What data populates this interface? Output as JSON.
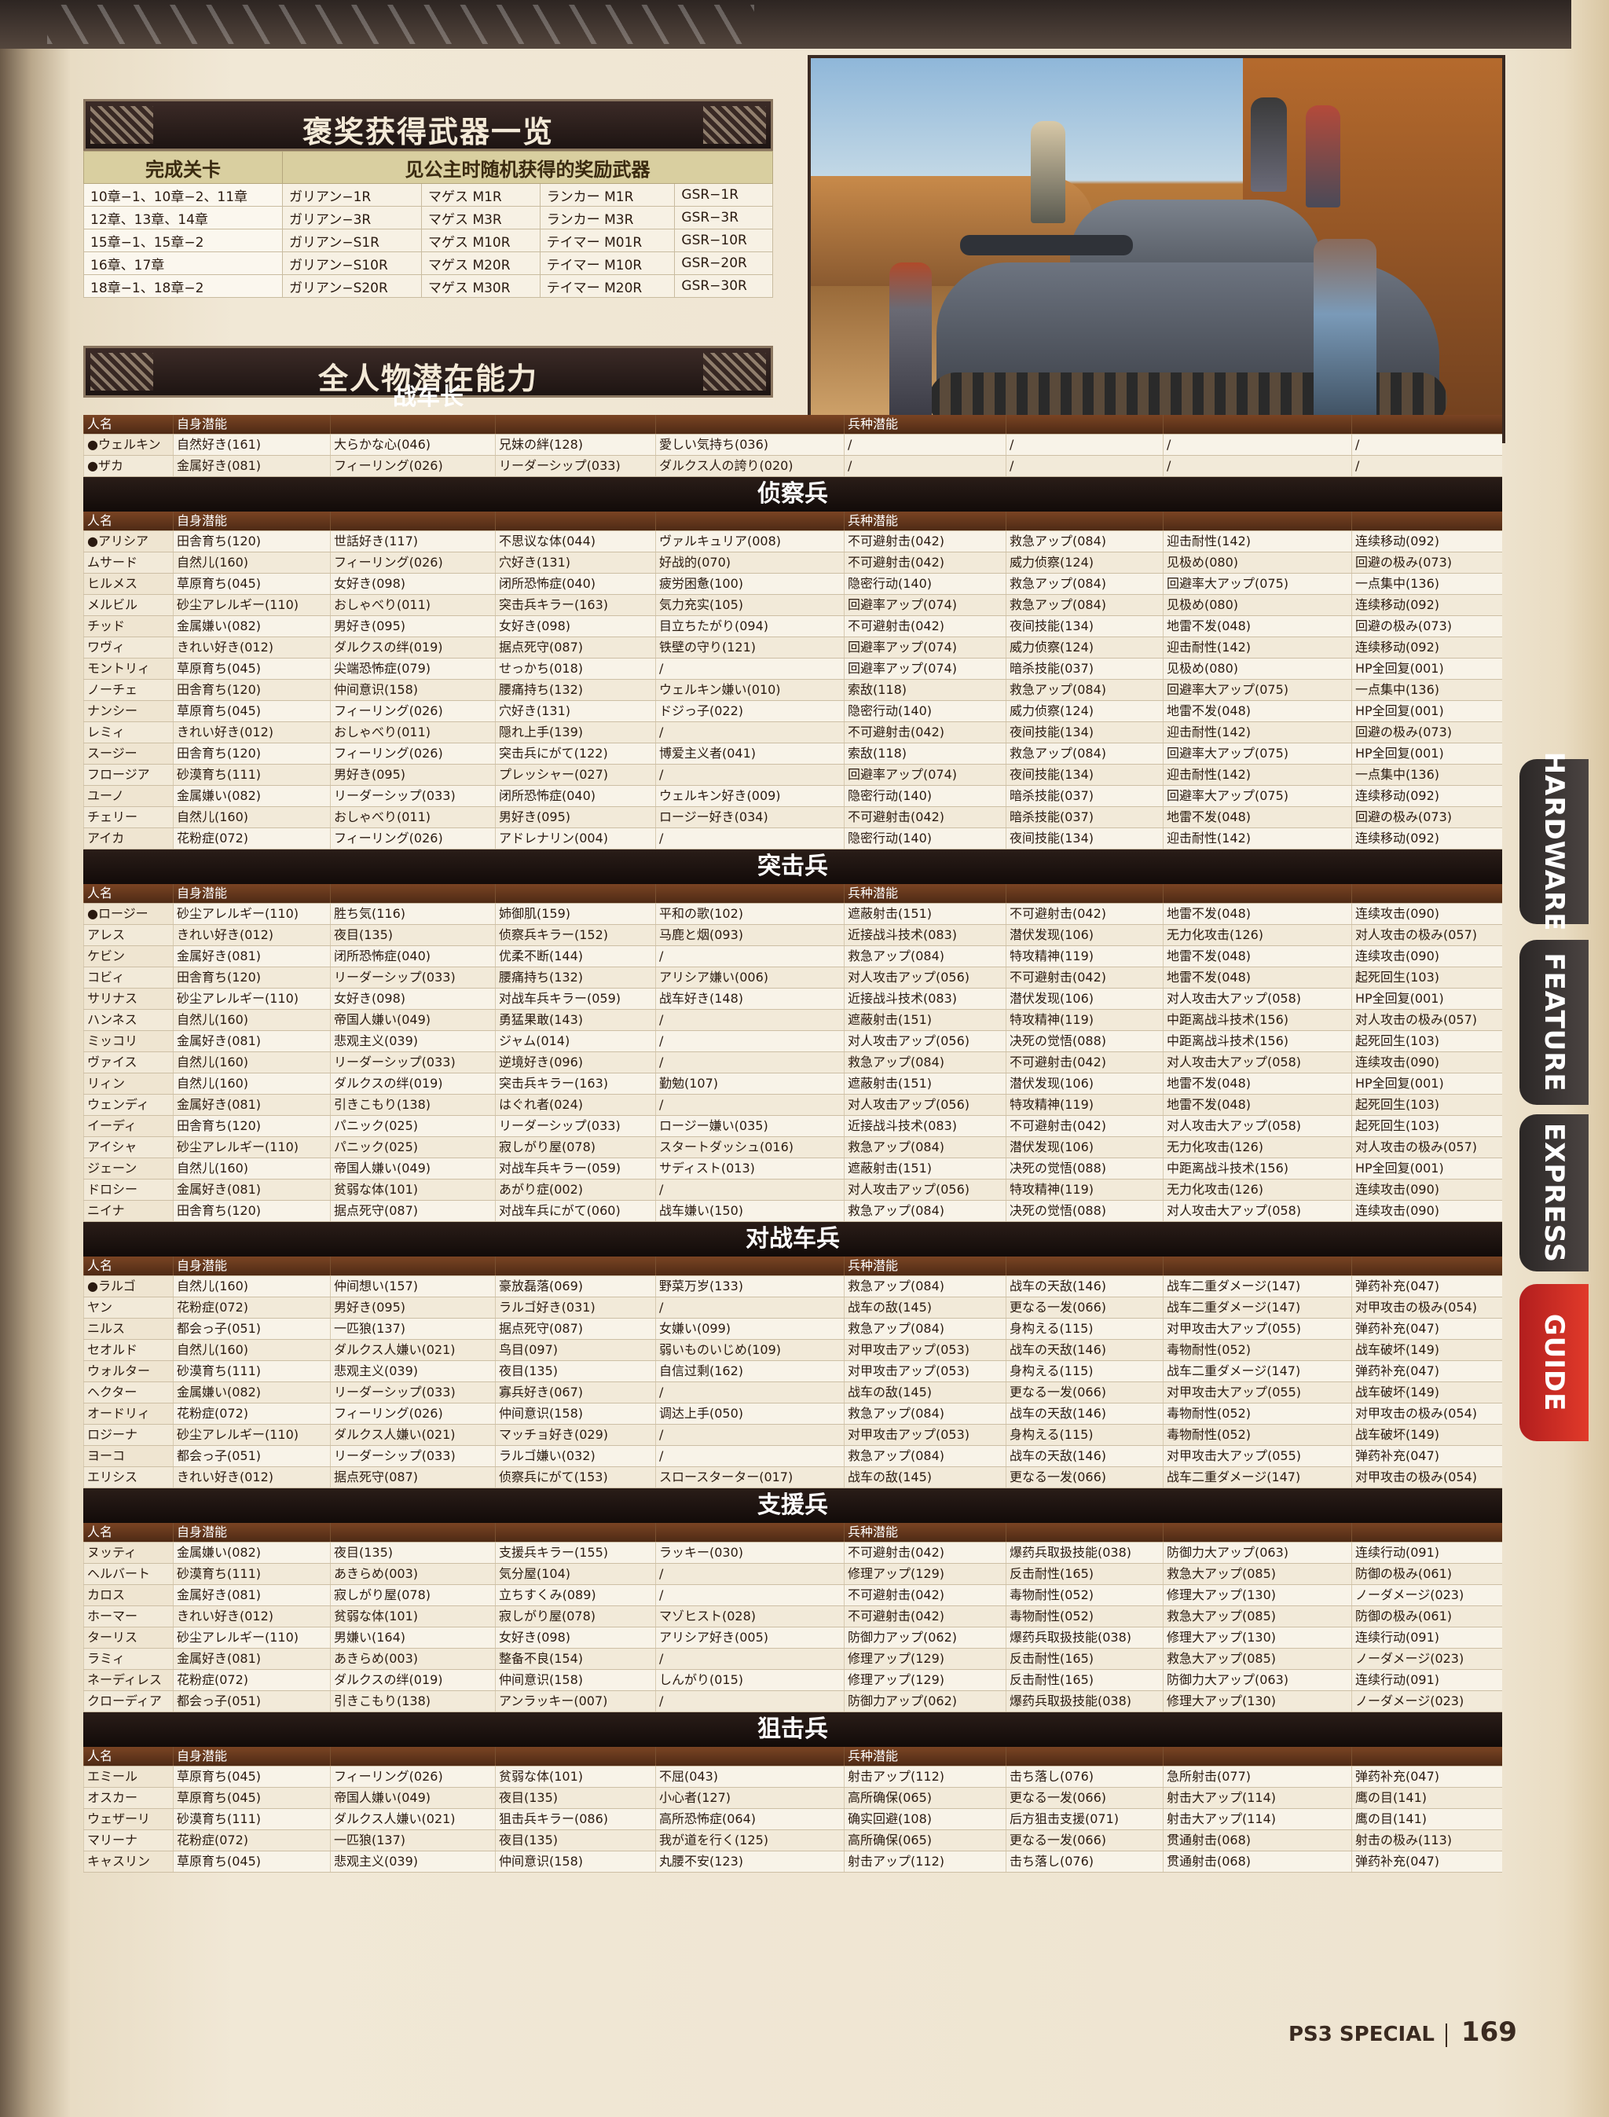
{
  "bonus_weapons": {
    "title": "褒奖获得武器一览",
    "col_stage": "完成关卡",
    "col_weapons": "见公主时随机获得的奖励武器",
    "rows": [
      [
        "10章−1、10章−2、11章",
        "ガリアン−1R",
        "マゲス M1R",
        "ランカー M1R",
        "GSR−1R"
      ],
      [
        "12章、13章、14章",
        "ガリアン−3R",
        "マゲス M3R",
        "ランカー M3R",
        "GSR−3R"
      ],
      [
        "15章−1、15章−2",
        "ガリアン−S1R",
        "マゲス M10R",
        "テイマー M01R",
        "GSR−10R"
      ],
      [
        "16章、17章",
        "ガリアン−S10R",
        "マゲス M20R",
        "テイマー M10R",
        "GSR−20R"
      ],
      [
        "18章−1、18章−2",
        "ガリアン−S20R",
        "マゲス M30R",
        "テイマー M20R",
        "GSR−30R"
      ]
    ]
  },
  "potential": {
    "title": "全人物潜在能力",
    "header": {
      "name": "人名",
      "self": "自身潜能",
      "class": "兵种潜能"
    },
    "classes": [
      {
        "name": "战车长",
        "rows": [
          [
            "●ウェルキン",
            "自然好き(161)",
            "大らかな心(046)",
            "兄妹の絆(128)",
            "愛しい気持ち(036)",
            "/",
            "/",
            "/",
            "/"
          ],
          [
            "●ザカ",
            "金属好き(081)",
            "フィーリング(026)",
            "リーダーシップ(033)",
            "ダルクス人の誇り(020)",
            "/",
            "/",
            "/",
            "/"
          ]
        ]
      },
      {
        "name": "侦察兵",
        "rows": [
          [
            "●アリシア",
            "田舎育ち(120)",
            "世話好き(117)",
            "不思议な体(044)",
            "ヴァルキュリア(008)",
            "不可避射击(042)",
            "救急アップ(084)",
            "迎击耐性(142)",
            "连续移动(092)"
          ],
          [
            "ムサード",
            "自然儿(160)",
            "フィーリング(026)",
            "穴好き(131)",
            "好战的(070)",
            "不可避射击(042)",
            "威力侦察(124)",
            "见极め(080)",
            "回避の极み(073)"
          ],
          [
            "ヒルメス",
            "草原育ち(045)",
            "女好き(098)",
            "闭所恐怖症(040)",
            "疲労困惫(100)",
            "隐密行动(140)",
            "救急アップ(084)",
            "回避率大アップ(075)",
            "一点集中(136)"
          ],
          [
            "メルビル",
            "砂尘アレルギー(110)",
            "おしゃべり(011)",
            "突击兵キラー(163)",
            "気力充实(105)",
            "回避率アップ(074)",
            "救急アップ(084)",
            "见极め(080)",
            "连续移动(092)"
          ],
          [
            "チッド",
            "金属嫌い(082)",
            "男好き(095)",
            "女好き(098)",
            "目立ちたがり(094)",
            "不可避射击(042)",
            "夜间技能(134)",
            "地雷不发(048)",
            "回避の极み(073)"
          ],
          [
            "ワヴィ",
            "きれい好き(012)",
            "ダルクスの绊(019)",
            "据点死守(087)",
            "铁壁の守り(121)",
            "回避率アップ(074)",
            "威力侦察(124)",
            "迎击耐性(142)",
            "连续移动(092)"
          ],
          [
            "モントリィ",
            "草原育ち(045)",
            "尖端恐怖症(079)",
            "せっかち(018)",
            "/",
            "回避率アップ(074)",
            "暗杀技能(037)",
            "见极め(080)",
            "HP全回复(001)"
          ],
          [
            "ノーチェ",
            "田舎育ち(120)",
            "仲间意识(158)",
            "腰痛持ち(132)",
            "ウェルキン嫌い(010)",
            "索敌(118)",
            "救急アップ(084)",
            "回避率大アップ(075)",
            "一点集中(136)"
          ],
          [
            "ナンシー",
            "草原育ち(045)",
            "フィーリング(026)",
            "穴好き(131)",
            "ドジっ子(022)",
            "隐密行动(140)",
            "威力侦察(124)",
            "地雷不发(048)",
            "HP全回复(001)"
          ],
          [
            "レミィ",
            "きれい好き(012)",
            "おしゃべり(011)",
            "隠れ上手(139)",
            "/",
            "不可避射击(042)",
            "夜间技能(134)",
            "迎击耐性(142)",
            "回避の极み(073)"
          ],
          [
            "スージー",
            "田舎育ち(120)",
            "フィーリング(026)",
            "突击兵にがて(122)",
            "博爱主义者(041)",
            "索敌(118)",
            "救急アップ(084)",
            "回避率大アップ(075)",
            "HP全回复(001)"
          ],
          [
            "フロージア",
            "砂漠育ち(111)",
            "男好き(095)",
            "プレッシャー(027)",
            "/",
            "回避率アップ(074)",
            "夜间技能(134)",
            "迎击耐性(142)",
            "一点集中(136)"
          ],
          [
            "ユーノ",
            "金属嫌い(082)",
            "リーダーシップ(033)",
            "闭所恐怖症(040)",
            "ウェルキン好き(009)",
            "隐密行动(140)",
            "暗杀技能(037)",
            "回避率大アップ(075)",
            "连续移动(092)"
          ],
          [
            "チェリー",
            "自然儿(160)",
            "おしゃべり(011)",
            "男好き(095)",
            "ロージー好き(034)",
            "不可避射击(042)",
            "暗杀技能(037)",
            "地雷不发(048)",
            "回避の极み(073)"
          ],
          [
            "アイカ",
            "花粉症(072)",
            "フィーリング(026)",
            "アドレナリン(004)",
            "/",
            "隐密行动(140)",
            "夜间技能(134)",
            "迎击耐性(142)",
            "连续移动(092)"
          ]
        ]
      },
      {
        "name": "突击兵",
        "rows": [
          [
            "●ロージー",
            "砂尘アレルギー(110)",
            "胜ち気(116)",
            "姉御肌(159)",
            "平和の歌(102)",
            "遮蔽射击(151)",
            "不可避射击(042)",
            "地雷不发(048)",
            "连续攻击(090)"
          ],
          [
            "アレス",
            "きれい好き(012)",
            "夜目(135)",
            "侦察兵キラー(152)",
            "马鹿と烟(093)",
            "近接战斗技术(083)",
            "潜伏发现(106)",
            "无力化攻击(126)",
            "对人攻击の极み(057)"
          ],
          [
            "ケビン",
            "金属好き(081)",
            "闭所恐怖症(040)",
            "优柔不断(144)",
            "/",
            "救急アップ(084)",
            "特攻精神(119)",
            "地雷不发(048)",
            "连续攻击(090)"
          ],
          [
            "コビィ",
            "田舎育ち(120)",
            "リーダーシップ(033)",
            "腰痛持ち(132)",
            "アリシア嫌い(006)",
            "对人攻击アップ(056)",
            "不可避射击(042)",
            "地雷不发(048)",
            "起死回生(103)"
          ],
          [
            "サリナス",
            "砂尘アレルギー(110)",
            "女好き(098)",
            "对战车兵キラー(059)",
            "战车好き(148)",
            "近接战斗技术(083)",
            "潜伏发现(106)",
            "对人攻击大アップ(058)",
            "HP全回复(001)"
          ],
          [
            "ハンネス",
            "自然儿(160)",
            "帝国人嫌い(049)",
            "勇猛果敢(143)",
            "/",
            "遮蔽射击(151)",
            "特攻精神(119)",
            "中距离战斗技术(156)",
            "对人攻击の极み(057)"
          ],
          [
            "ミッコリ",
            "金属好き(081)",
            "悲观主义(039)",
            "ジャム(014)",
            "/",
            "对人攻击アップ(056)",
            "决死の觉悟(088)",
            "中距离战斗技术(156)",
            "起死回生(103)"
          ],
          [
            "ヴァイス",
            "自然儿(160)",
            "リーダーシップ(033)",
            "逆境好き(096)",
            "/",
            "救急アップ(084)",
            "不可避射击(042)",
            "对人攻击大アップ(058)",
            "连续攻击(090)"
          ],
          [
            "リィン",
            "自然儿(160)",
            "ダルクスの绊(019)",
            "突击兵キラー(163)",
            "勤勉(107)",
            "遮蔽射击(151)",
            "潜伏发现(106)",
            "地雷不发(048)",
            "HP全回复(001)"
          ],
          [
            "ウェンディ",
            "金属好き(081)",
            "引きこもり(138)",
            "はぐれ者(024)",
            "/",
            "对人攻击アップ(056)",
            "特攻精神(119)",
            "地雷不发(048)",
            "起死回生(103)"
          ],
          [
            "イーディ",
            "田舎育ち(120)",
            "パニック(025)",
            "リーダーシップ(033)",
            "ロージー嫌い(035)",
            "近接战斗技术(083)",
            "不可避射击(042)",
            "对人攻击大アップ(058)",
            "起死回生(103)"
          ],
          [
            "アイシャ",
            "砂尘アレルギー(110)",
            "パニック(025)",
            "寂しがり屋(078)",
            "スタートダッシュ(016)",
            "救急アップ(084)",
            "潜伏发现(106)",
            "无力化攻击(126)",
            "对人攻击の极み(057)"
          ],
          [
            "ジェーン",
            "自然儿(160)",
            "帝国人嫌い(049)",
            "对战车兵キラー(059)",
            "サディスト(013)",
            "遮蔽射击(151)",
            "决死の觉悟(088)",
            "中距离战斗技术(156)",
            "HP全回复(001)"
          ],
          [
            "ドロシー",
            "金属好き(081)",
            "贫弱な体(101)",
            "あがり症(002)",
            "/",
            "对人攻击アップ(056)",
            "特攻精神(119)",
            "无力化攻击(126)",
            "连续攻击(090)"
          ],
          [
            "ニイナ",
            "田舎育ち(120)",
            "据点死守(087)",
            "对战车兵にがて(060)",
            "战车嫌い(150)",
            "救急アップ(084)",
            "决死の觉悟(088)",
            "对人攻击大アップ(058)",
            "连续攻击(090)"
          ]
        ]
      },
      {
        "name": "对战车兵",
        "rows": [
          [
            "●ラルゴ",
            "自然儿(160)",
            "仲间想い(157)",
            "豪放磊落(069)",
            "野菜万岁(133)",
            "救急アップ(084)",
            "战车の天敌(146)",
            "战车二重ダメージ(147)",
            "弹药补充(047)"
          ],
          [
            "ヤン",
            "花粉症(072)",
            "男好き(095)",
            "ラルゴ好き(031)",
            "/",
            "战车の敌(145)",
            "更なる一发(066)",
            "战车二重ダメージ(147)",
            "对甲攻击の极み(054)"
          ],
          [
            "ニルス",
            "都会っ子(051)",
            "一匹狼(137)",
            "据点死守(087)",
            "女嫌い(099)",
            "救急アップ(084)",
            "身构える(115)",
            "对甲攻击大アップ(055)",
            "弹药补充(047)"
          ],
          [
            "セオルド",
            "自然儿(160)",
            "ダルクス人嫌い(021)",
            "鸟目(097)",
            "弱いものいじめ(109)",
            "对甲攻击アップ(053)",
            "战车の天敌(146)",
            "毒物耐性(052)",
            "战车破坏(149)"
          ],
          [
            "ウォルター",
            "砂漠育ち(111)",
            "悲观主义(039)",
            "夜目(135)",
            "自信过剩(162)",
            "对甲攻击アップ(053)",
            "身构える(115)",
            "战车二重ダメージ(147)",
            "弹药补充(047)"
          ],
          [
            "ヘクター",
            "金属嫌い(082)",
            "リーダーシップ(033)",
            "寡兵好き(067)",
            "/",
            "战车の敌(145)",
            "更なる一发(066)",
            "对甲攻击大アップ(055)",
            "战车破坏(149)"
          ],
          [
            "オードリィ",
            "花粉症(072)",
            "フィーリング(026)",
            "仲间意识(158)",
            "调达上手(050)",
            "救急アップ(084)",
            "战车の天敌(146)",
            "毒物耐性(052)",
            "对甲攻击の极み(054)"
          ],
          [
            "ロジーナ",
            "砂尘アレルギー(110)",
            "ダルクス人嫌い(021)",
            "マッチョ好き(029)",
            "/",
            "对甲攻击アップ(053)",
            "身构える(115)",
            "毒物耐性(052)",
            "战车破坏(149)"
          ],
          [
            "ヨーコ",
            "都会っ子(051)",
            "リーダーシップ(033)",
            "ラルゴ嫌い(032)",
            "/",
            "救急アップ(084)",
            "战车の天敌(146)",
            "对甲攻击大アップ(055)",
            "弹药补充(047)"
          ],
          [
            "エリシス",
            "きれい好き(012)",
            "据点死守(087)",
            "侦察兵にがて(153)",
            "スロースターター(017)",
            "战车の敌(145)",
            "更なる一发(066)",
            "战车二重ダメージ(147)",
            "对甲攻击の极み(054)"
          ]
        ]
      },
      {
        "name": "支援兵",
        "rows": [
          [
            "ヌッティ",
            "金属嫌い(082)",
            "夜目(135)",
            "支援兵キラー(155)",
            "ラッキー(030)",
            "不可避射击(042)",
            "爆药兵取扱技能(038)",
            "防御力大アップ(063)",
            "连续行动(091)"
          ],
          [
            "ヘルバート",
            "砂漠育ち(111)",
            "あきらめ(003)",
            "気分屋(104)",
            "/",
            "修理アップ(129)",
            "反击耐性(165)",
            "救急大アップ(085)",
            "防御の极み(061)"
          ],
          [
            "カロス",
            "金属好き(081)",
            "寂しがり屋(078)",
            "立ちすくみ(089)",
            "/",
            "不可避射击(042)",
            "毒物耐性(052)",
            "修理大アップ(130)",
            "ノーダメージ(023)"
          ],
          [
            "ホーマー",
            "きれい好き(012)",
            "贫弱な体(101)",
            "寂しがり屋(078)",
            "マゾヒスト(028)",
            "不可避射击(042)",
            "毒物耐性(052)",
            "救急大アップ(085)",
            "防御の极み(061)"
          ],
          [
            "ターリス",
            "砂尘アレルギー(110)",
            "男嫌い(164)",
            "女好き(098)",
            "アリシア好き(005)",
            "防御力アップ(062)",
            "爆药兵取扱技能(038)",
            "修理大アップ(130)",
            "连续行动(091)"
          ],
          [
            "ラミィ",
            "金属好き(081)",
            "あきらめ(003)",
            "整备不良(154)",
            "/",
            "修理アップ(129)",
            "反击耐性(165)",
            "救急大アップ(085)",
            "ノーダメージ(023)"
          ],
          [
            "ネーディレス",
            "花粉症(072)",
            "ダルクスの绊(019)",
            "仲间意识(158)",
            "しんがり(015)",
            "修理アップ(129)",
            "反击耐性(165)",
            "防御力大アップ(063)",
            "连续行动(091)"
          ],
          [
            "クローディア",
            "都会っ子(051)",
            "引きこもり(138)",
            "アンラッキー(007)",
            "/",
            "防御力アップ(062)",
            "爆药兵取扱技能(038)",
            "修理大アップ(130)",
            "ノーダメージ(023)"
          ]
        ]
      },
      {
        "name": "狙击兵",
        "rows": [
          [
            "エミール",
            "草原育ち(045)",
            "フィーリング(026)",
            "贫弱な体(101)",
            "不屈(043)",
            "射击アップ(112)",
            "击ち落し(076)",
            "急所射击(077)",
            "弹药补充(047)"
          ],
          [
            "オスカー",
            "草原育ち(045)",
            "帝国人嫌い(049)",
            "夜目(135)",
            "小心者(127)",
            "高所确保(065)",
            "更なる一发(066)",
            "射击大アップ(114)",
            "鹰の目(141)"
          ],
          [
            "ウェザーリ",
            "砂漠育ち(111)",
            "ダルクス人嫌い(021)",
            "狙击兵キラー(086)",
            "高所恐怖症(064)",
            "确实回避(108)",
            "后方狙击支援(071)",
            "射击大アップ(114)",
            "鹰の目(141)"
          ],
          [
            "マリーナ",
            "花粉症(072)",
            "一匹狼(137)",
            "夜目(135)",
            "我が道を行く(125)",
            "高所确保(065)",
            "更なる一发(066)",
            "贯通射击(068)",
            "射击の极み(113)"
          ],
          [
            "キャスリン",
            "草原育ち(045)",
            "悲观主义(039)",
            "仲间意识(158)",
            "丸腰不安(123)",
            "射击アップ(112)",
            "击ち落し(076)",
            "贯通射击(068)",
            "弹药补充(047)"
          ]
        ]
      }
    ]
  },
  "tabs": [
    "HARDWARE",
    "FEATURE",
    "EXPRESS",
    "GUIDE"
  ],
  "footer": {
    "mag": "PS3 SPECIAL",
    "page": "169"
  }
}
